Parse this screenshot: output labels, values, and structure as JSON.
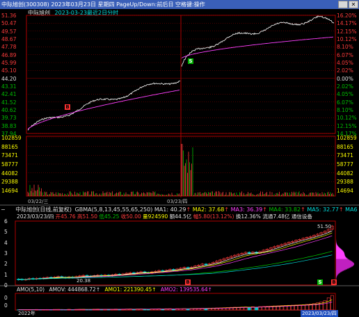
{
  "window": {
    "title": "中际旭创(300308)  2023年03月23日  星期四  PageUp/Down:前后日  空格键:操作",
    "min_label": "—",
    "close_label": "✕"
  },
  "intraday": {
    "name": "中际旭创",
    "date_range": "2023-03-23最近2日分时",
    "left_ticks": [
      "51.36",
      "50.47",
      "49.57",
      "48.67",
      "47.78",
      "46.89",
      "45.99",
      "45.10",
      "44.20",
      "43.31",
      "42.41",
      "41.52",
      "40.62",
      "39.73",
      "38.83",
      "37.94"
    ],
    "right_ticks": [
      "16.20%",
      "14.17%",
      "12.15%",
      "10.12%",
      "8.10%",
      "6.07%",
      "4.05%",
      "2.02%",
      "0.00%",
      "2.02%",
      "4.05%",
      "6.07%",
      "8.10%",
      "10.12%",
      "12.15%",
      "14.17%"
    ],
    "price_ylim": [
      37.94,
      51.36
    ],
    "prev_close": 44.2,
    "buy_marker": "B",
    "sell_marker": "S",
    "volume_ticks": [
      "102859",
      "88165",
      "73471",
      "58777",
      "44082",
      "29388",
      "14694"
    ],
    "volume_ylim": [
      0,
      102859
    ],
    "day1_label": "03/22/三",
    "day2_label": "03/23/四"
  },
  "daily": {
    "header": {
      "minus": "−",
      "name": "中际旭创(日线,前复权)",
      "gbma": "GBMA(5,8,13,45,55,65,250)",
      "ma1": "MA1: 40.29",
      "ma2": "MA2: 37.68",
      "ma3": "MA3: 36.39",
      "ma4": "MA4: 33.82",
      "ma5": "MA5: 32.77",
      "ma6": "MA6"
    },
    "info": {
      "date": "2023/03/23/四",
      "open": "开45.76",
      "high": "高51.50",
      "low": "低45.25",
      "close": "收50.00",
      "volume": "量924590",
      "amount": "额44.5亿",
      "change": "幅5.80(13.12%)",
      "turnover": "换12.36%",
      "float": "流通7.48亿",
      "industry": "通信设备"
    },
    "left_ticks": [
      "6",
      "5",
      "4",
      "3",
      "2",
      "1",
      "0"
    ],
    "price_note": "51.50",
    "low_note": "20.38",
    "markers": [
      "B",
      "S",
      "B"
    ],
    "candles_up": [
      0,
      0,
      1,
      1,
      0,
      1,
      0,
      1,
      1,
      0,
      1,
      1,
      0,
      0,
      1,
      0,
      1,
      1,
      1,
      0,
      0,
      1,
      1,
      0,
      1,
      0,
      1,
      1,
      0,
      1,
      1,
      1,
      0,
      1,
      1,
      0,
      0,
      1,
      1,
      1,
      0,
      1,
      1,
      0,
      1,
      1,
      1,
      0,
      1,
      1,
      1,
      1,
      0,
      1,
      1,
      1,
      1,
      1,
      1,
      1,
      1,
      1,
      1,
      1,
      0,
      1,
      0,
      1,
      1,
      1,
      1,
      1,
      1,
      1,
      1,
      1,
      1,
      1,
      1,
      1,
      1,
      1,
      1,
      1,
      1,
      1,
      1,
      1
    ],
    "close_values": [
      20.5,
      20.1,
      20.4,
      20.9,
      20.6,
      21.0,
      20.8,
      21.3,
      21.5,
      21.2,
      21.6,
      21.9,
      21.5,
      21.2,
      21.7,
      21.4,
      21.9,
      22.3,
      22.6,
      22.2,
      21.9,
      22.4,
      22.7,
      22.3,
      22.8,
      22.4,
      22.9,
      23.3,
      22.9,
      23.4,
      23.8,
      24.1,
      23.7,
      24.2,
      24.6,
      24.2,
      23.9,
      24.5,
      24.9,
      25.3,
      24.8,
      25.4,
      25.9,
      25.5,
      26.1,
      26.6,
      27.0,
      26.5,
      27.2,
      27.8,
      28.3,
      28.9,
      28.4,
      29.1,
      29.8,
      30.5,
      31.2,
      31.9,
      32.5,
      33.2,
      33.8,
      34.3,
      34.9,
      35.4,
      34.8,
      35.5,
      34.9,
      35.8,
      36.6,
      37.2,
      37.9,
      38.6,
      39.1,
      39.8,
      40.4,
      41.0,
      41.5,
      42.1,
      42.6,
      43.2,
      43.7,
      44.2,
      44.9,
      45.5,
      46.3,
      47.1,
      48.2,
      50.0
    ],
    "volume_values": [
      20,
      25,
      18,
      30,
      22,
      35,
      28,
      26,
      33,
      30,
      40,
      38,
      25,
      22,
      45,
      30,
      42,
      50,
      48,
      26,
      30,
      55,
      60,
      40,
      52,
      35,
      48,
      62,
      44,
      58,
      65,
      70,
      42,
      66,
      72,
      50,
      45,
      68,
      74,
      80,
      55,
      82,
      88,
      60,
      90,
      85,
      95,
      70,
      98,
      105,
      110,
      118,
      90,
      120,
      125,
      135,
      140,
      150,
      160,
      170,
      180,
      175,
      190,
      200,
      150,
      210,
      160,
      220,
      230,
      240,
      250,
      260,
      270,
      280,
      290,
      300,
      310,
      320,
      330,
      340,
      360,
      380,
      420,
      460,
      520,
      600,
      780,
      924.59
    ],
    "year_label": "2022年",
    "date_label": "2023/03/23/四"
  },
  "amo": {
    "name": "AMO(5,10)",
    "amov": "AMOV: 444868.72↑",
    "amo1": "AMO1: 221390.45↑",
    "amo2": "AMO2: 139535.64↑",
    "left_ticks": [
      "0",
      "0"
    ]
  },
  "colors": {
    "up": "#ff3c3c",
    "down": "#00c8c8",
    "price_line": "#ffffff",
    "avg_line": "#ff40ff",
    "grid": "#7a0000",
    "divider": "#b00000"
  }
}
